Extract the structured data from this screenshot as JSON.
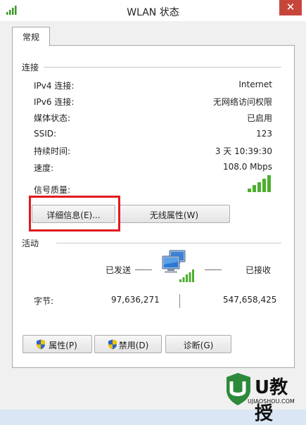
{
  "window": {
    "title": "WLAN 状态",
    "close_glyph": "✕"
  },
  "tabs": [
    {
      "label": "常规",
      "selected": true
    }
  ],
  "connection": {
    "section_label": "连接",
    "rows": [
      {
        "label": "IPv4 连接:",
        "value": "Internet"
      },
      {
        "label": "IPv6 连接:",
        "value": "无网络访问权限"
      },
      {
        "label": "媒体状态:",
        "value": "已启用"
      },
      {
        "label": "SSID:",
        "value": "123"
      },
      {
        "label": "持续时间:",
        "value": "3 天 10:39:30"
      },
      {
        "label": "速度:",
        "value": "108.0 Mbps"
      }
    ],
    "signal_label": "信号质量:",
    "signal_bars": 5,
    "signal_color": "#4caf2e"
  },
  "buttons": {
    "details": "详细信息(E)...",
    "wireless_properties": "无线属性(W)",
    "properties": "属性(P)",
    "disable": "禁用(D)",
    "diagnose": "诊断(G)"
  },
  "activity": {
    "section_label": "活动",
    "sent_label": "已发送",
    "received_label": "已接收",
    "bytes_label": "字节:",
    "bytes_sent": "97,636,271",
    "bytes_received": "547,658,425"
  },
  "watermark": {
    "brand": "U教授",
    "url": "UJIAOSHOU.COM"
  },
  "colors": {
    "highlight": "#e1191e",
    "close_button": "#c7463c",
    "shield_blue": "#2b63c6",
    "shield_yellow": "#f2c200"
  }
}
